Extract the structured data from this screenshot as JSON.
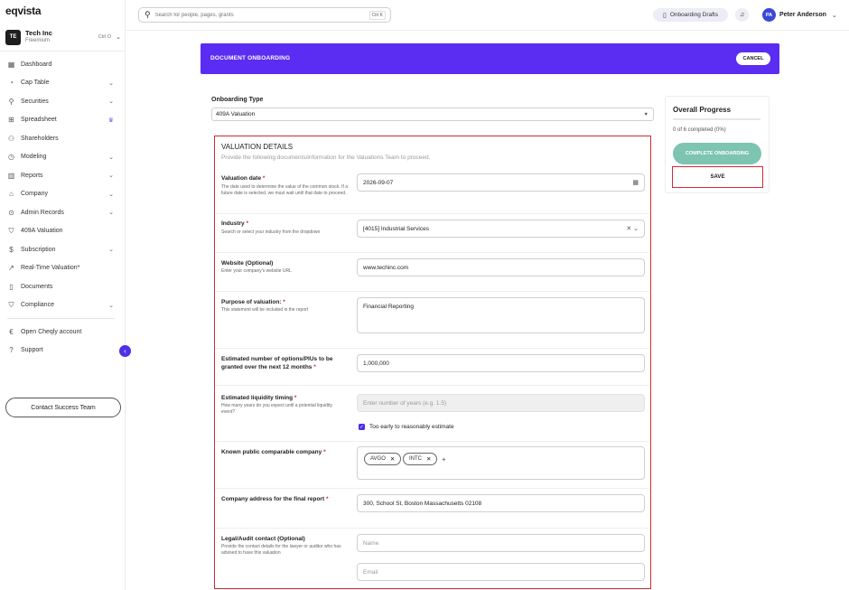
{
  "app": {
    "logo": "eqvista"
  },
  "company": {
    "initials": "TE",
    "name": "Tech Inc",
    "plan": "Freemium",
    "shortcut": "Ctrl O"
  },
  "sidebar": {
    "items": [
      {
        "label": "Dashboard",
        "icon": "dashboard-icon",
        "expandable": false
      },
      {
        "label": "Cap Table",
        "icon": "pie-chart-icon",
        "expandable": true
      },
      {
        "label": "Securities",
        "icon": "securities-icon",
        "expandable": true
      },
      {
        "label": "Spreadsheet",
        "icon": "spreadsheet-icon",
        "expandable": false,
        "premium": true
      },
      {
        "label": "Shareholders",
        "icon": "users-icon",
        "expandable": false
      },
      {
        "label": "Modeling",
        "icon": "modeling-icon",
        "expandable": true
      },
      {
        "label": "Reports",
        "icon": "reports-icon",
        "expandable": true
      },
      {
        "label": "Company",
        "icon": "company-icon",
        "expandable": true
      },
      {
        "label": "Admin Records",
        "icon": "admin-icon",
        "expandable": true
      },
      {
        "label": "409A Valuation",
        "icon": "shield-check-icon",
        "expandable": false
      },
      {
        "label": "Subscription",
        "icon": "subscription-icon",
        "expandable": true
      },
      {
        "label": "Real-Time Valuation*",
        "icon": "trend-icon",
        "expandable": false
      },
      {
        "label": "Documents",
        "icon": "documents-icon",
        "expandable": false
      },
      {
        "label": "Compliance",
        "icon": "compliance-icon",
        "expandable": true
      }
    ],
    "extra": [
      {
        "label": "Open Cheqly account",
        "icon": "cheqly-icon"
      },
      {
        "label": "Support",
        "icon": "help-icon"
      }
    ],
    "contact_button": "Contact Success Team"
  },
  "topbar": {
    "search_placeholder": "Search for people, pages, grants",
    "search_shortcut": "Ctrl K",
    "drafts_label": "Onboarding Drafts",
    "user_initials": "PA",
    "user_name": "Peter Anderson"
  },
  "header": {
    "title": "DOCUMENT ONBOARDING",
    "cancel_label": "CANCEL"
  },
  "onboarding_type": {
    "label": "Onboarding Type",
    "value": "409A Valuation"
  },
  "progress": {
    "title": "Overall Progress",
    "completed": 0,
    "total": 6,
    "text": "0 of 6 completed (0%)",
    "complete_label": "COMPLETE ONBOARDING",
    "save_label": "SAVE",
    "colors": {
      "complete": "#7dc4b1",
      "highlight": "#d12a37"
    }
  },
  "valuation": {
    "title": "VALUATION DETAILS",
    "subtitle": "Provide the following documents/information for the Valuations Team to proceed.",
    "fields": {
      "date": {
        "label": "Valuation date",
        "help": "The date used to determine the value of the common stock. If a future date is selected, we must wait until that date to proceed.",
        "value": "2026-09-07"
      },
      "industry": {
        "label": "Industry",
        "help": "Search or select your industry from the dropdown",
        "value": "[4015] Industrial Services"
      },
      "website": {
        "label": "Website (Optional)",
        "help": "Enter your company's website URL",
        "value": "www.techinc.com"
      },
      "purpose": {
        "label": "Purpose of valuation:",
        "help": "This statement will be included in the report",
        "value": "Financial Reporting"
      },
      "options": {
        "label": "Estimated number of options/PIUs to be granted over the next 12 months",
        "value": "1,000,000"
      },
      "liquidity": {
        "label": "Estimated liquidity timing",
        "help": "How many years do you expect until a potential liquidity event?",
        "placeholder": "Enter number of years (e.g. 1.5)",
        "checkbox_label": "Too early to reasonably estimate",
        "checked": true
      },
      "comparables": {
        "label": "Known public comparable company",
        "chips": [
          "AVGO",
          "INTC"
        ]
      },
      "address": {
        "label": "Company address for the final report",
        "value": "300, School St, Boston Massachusetts 02108"
      },
      "legal": {
        "label": "Legal/Audit contact (Optional)",
        "help": "Provide the contact details for the lawyer or auditor who has advised to have this valuation",
        "name_placeholder": "Name",
        "email_placeholder": "Email"
      }
    }
  },
  "colors": {
    "brand": "#5b2cf2",
    "accent": "#4f2ee8"
  }
}
